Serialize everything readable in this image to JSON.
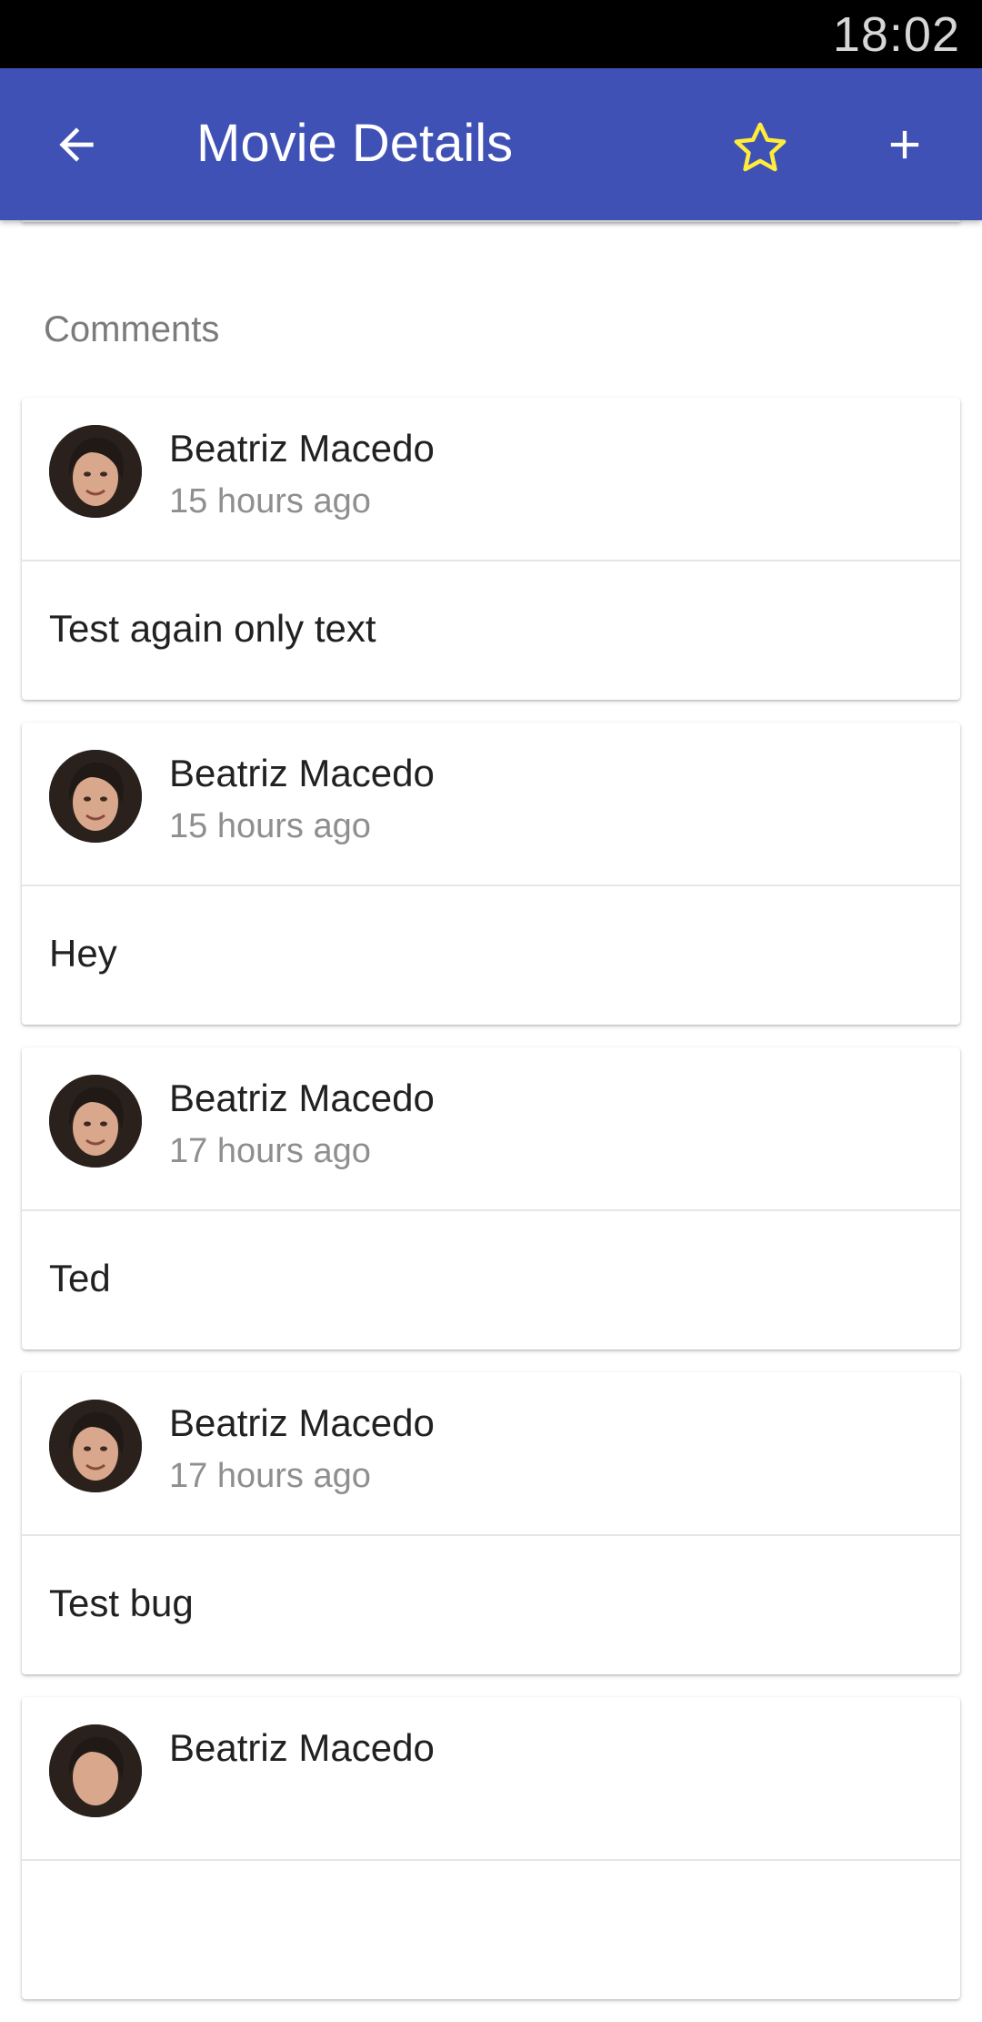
{
  "status_bar": {
    "time": "18:02"
  },
  "app_bar": {
    "title": "Movie Details",
    "back_icon": "arrow-left-icon",
    "favorite_icon": "star-outline-icon",
    "add_icon": "plus-icon",
    "background_color": "#3f51b5",
    "favorite_color": "#ffeb3b"
  },
  "comments_section": {
    "heading": "Comments",
    "items": [
      {
        "author": "Beatriz Macedo",
        "time": "15 hours ago",
        "text": "Test again only text"
      },
      {
        "author": "Beatriz Macedo",
        "time": "15 hours ago",
        "text": "Hey"
      },
      {
        "author": "Beatriz Macedo",
        "time": "17 hours ago",
        "text": "Ted"
      },
      {
        "author": "Beatriz Macedo",
        "time": "17 hours ago",
        "text": "Test bug"
      },
      {
        "author": "Beatriz Macedo",
        "time": "",
        "text": ""
      }
    ]
  }
}
